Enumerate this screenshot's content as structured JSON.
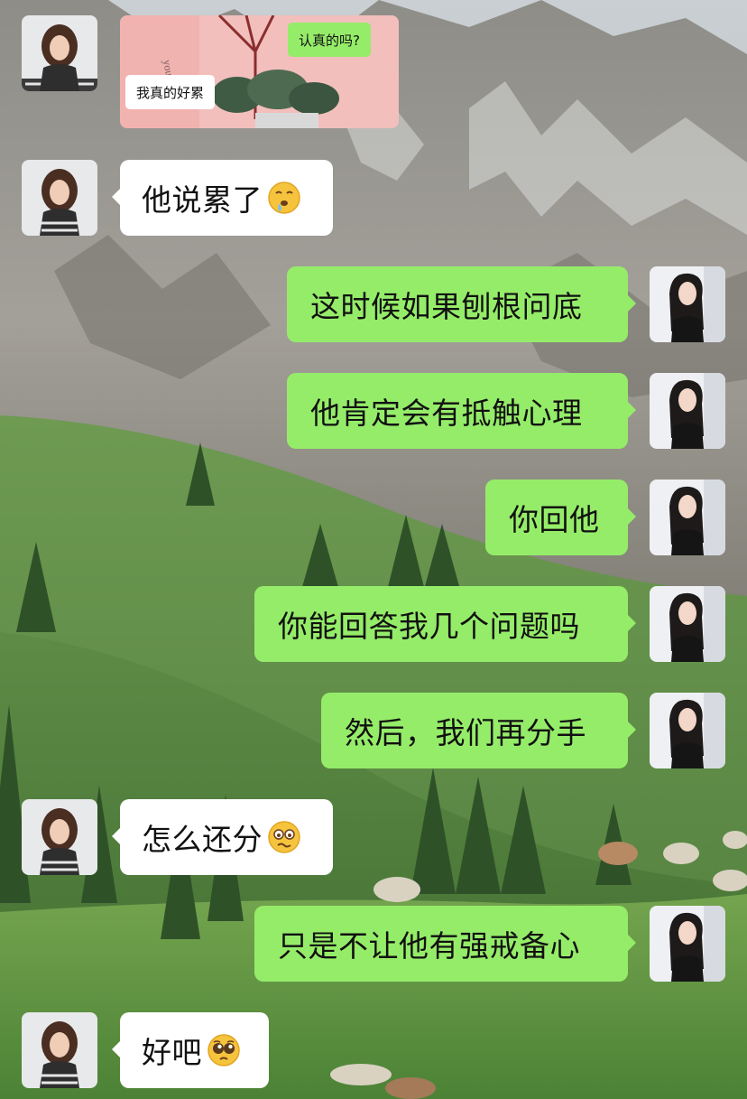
{
  "image_message": {
    "bubble_right": "认真的吗?",
    "bubble_left": "我真的好累"
  },
  "messages": [
    {
      "side": "left",
      "text": "他说累了",
      "emoji": "drooling-face-icon"
    },
    {
      "side": "right",
      "text": "这时候如果刨根问底"
    },
    {
      "side": "right",
      "text": "他肯定会有抵触心理"
    },
    {
      "side": "right",
      "text": "你回他"
    },
    {
      "side": "right",
      "text": "你能回答我几个问题吗"
    },
    {
      "side": "right",
      "text": "然后，我们再分手"
    },
    {
      "side": "left",
      "text": "怎么还分",
      "emoji": "woozy-face-icon"
    },
    {
      "side": "right",
      "text": "只是不让他有强戒备心"
    },
    {
      "side": "left",
      "text": "好吧",
      "emoji": "pleading-face-icon"
    }
  ],
  "colors": {
    "sent_bubble": "#95ec69",
    "received_bubble": "#ffffff"
  }
}
